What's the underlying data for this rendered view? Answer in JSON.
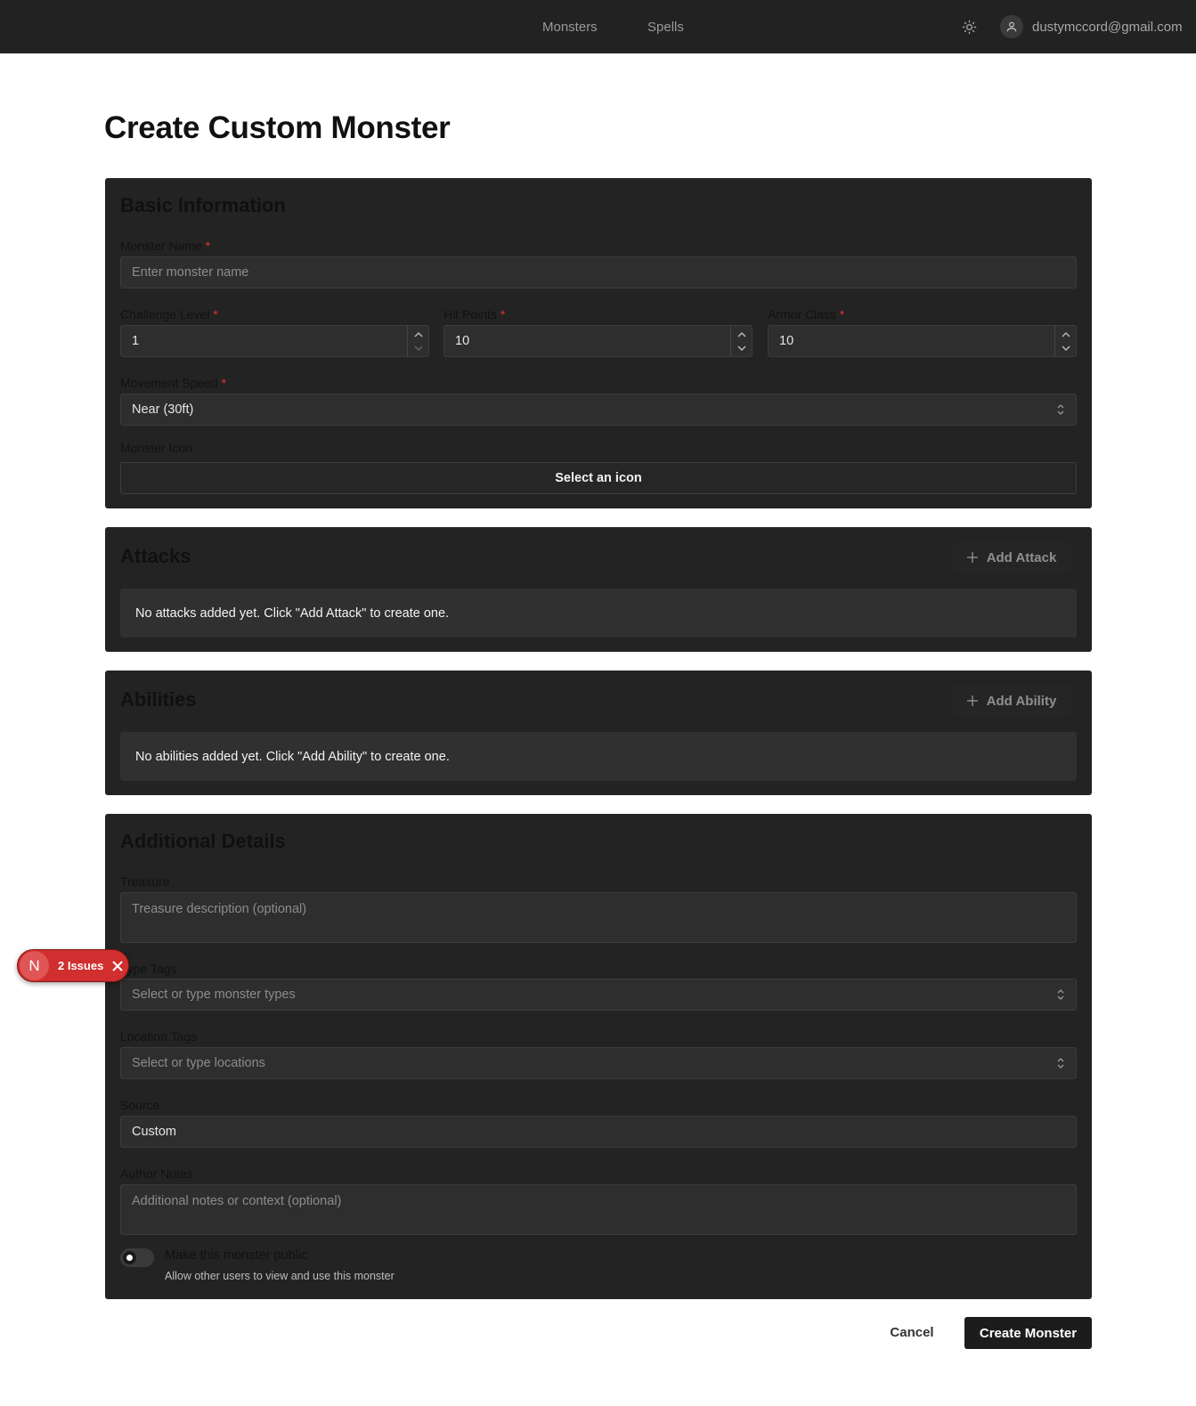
{
  "nav": {
    "monsters": "Monsters",
    "spells": "Spells",
    "theme_icon": "sun-icon",
    "user_icon": "user-icon",
    "email": "dustymccord@gmail.com"
  },
  "page_title": "Create Custom Monster",
  "basic": {
    "title": "Basic Information",
    "monster_name": {
      "label": "Monster Name",
      "required": "*",
      "placeholder": "Enter monster name",
      "value": ""
    },
    "challenge_level": {
      "label": "Challenge Level",
      "required": "*",
      "value": "1"
    },
    "hit_points": {
      "label": "Hit Points",
      "required": "*",
      "value": "10"
    },
    "armor_class": {
      "label": "Armor Class",
      "required": "*",
      "value": "10"
    },
    "movement_speed": {
      "label": "Movement Speed",
      "required": "*",
      "value": "Near (30ft)"
    },
    "monster_icon": {
      "label": "Monster Icon",
      "button": "Select an icon"
    }
  },
  "attacks": {
    "title": "Attacks",
    "add_label": "Add Attack",
    "empty": "No attacks added yet. Click \"Add Attack\" to create one."
  },
  "abilities": {
    "title": "Abilities",
    "add_label": "Add Ability",
    "empty": "No abilities added yet. Click \"Add Ability\" to create one."
  },
  "details": {
    "title": "Additional Details",
    "treasure": {
      "label": "Treasure",
      "placeholder": "Treasure description (optional)"
    },
    "type_tags": {
      "label": "Type Tags",
      "placeholder": "Select or type monster types"
    },
    "location_tags": {
      "label": "Location Tags",
      "placeholder": "Select or type locations"
    },
    "source": {
      "label": "Source",
      "value": "Custom"
    },
    "author_notes": {
      "label": "Author Notes",
      "placeholder": "Additional notes or context (optional)"
    },
    "public_toggle": {
      "label": "Make this monster public",
      "sub": "Allow other users to view and use this monster",
      "checked": false
    }
  },
  "actions": {
    "cancel": "Cancel",
    "create": "Create Monster"
  },
  "issues_badge": {
    "letter": "N",
    "text": "2 Issues"
  },
  "colors": {
    "topbar": "#222222",
    "card": "#232323",
    "field": "#2e2e2e",
    "required": "#e0342f",
    "issues": "#d12f2f"
  }
}
